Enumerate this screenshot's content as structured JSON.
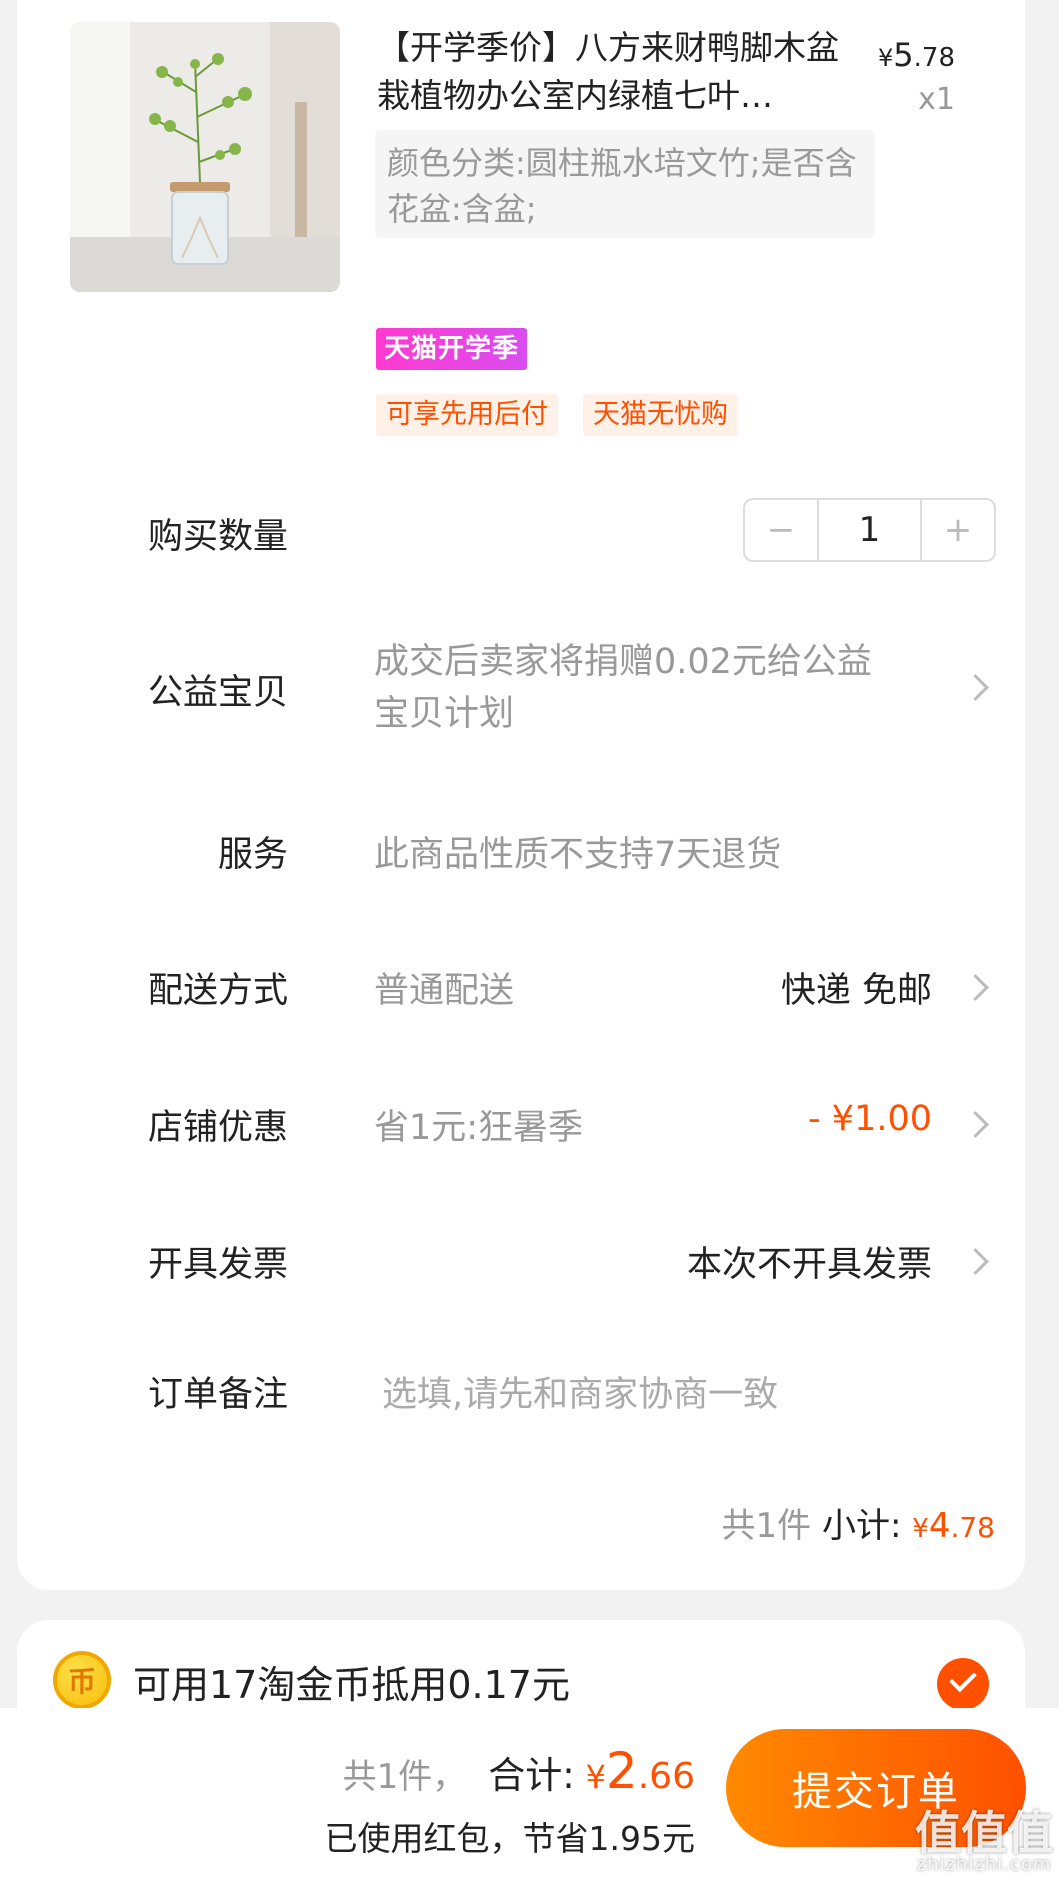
{
  "item": {
    "title": "【开学季价】八方来财鸭脚木盆栽植物办公室内绿植七叶…",
    "price": {
      "currency": "¥",
      "integer": "5",
      "decimal": ".78"
    },
    "quantity_label": "x1",
    "sku": "颜色分类:圆柱瓶水培文竹;是否含花盆:含盆;",
    "promo_badge": "天猫开学季",
    "tags": [
      "可享先用后付",
      "天猫无忧购"
    ]
  },
  "rows": {
    "quantity": {
      "label": "购买数量",
      "value": "1",
      "minus": "−",
      "plus": "+"
    },
    "charity": {
      "label": "公益宝贝",
      "value_line1": "成交后卖家将捐赠0.02元给公益",
      "value_line2": "宝贝计划"
    },
    "service": {
      "label": "服务",
      "value": "此商品性质不支持7天退货"
    },
    "delivery": {
      "label": "配送方式",
      "value": "普通配送",
      "right": "快递 免邮"
    },
    "shop_discount": {
      "label": "店铺优惠",
      "value": "省1元:狂暑季",
      "right": "- ¥1.00"
    },
    "invoice": {
      "label": "开具发票",
      "right": "本次不开具发票"
    },
    "note": {
      "label": "订单备注",
      "placeholder": "选填,请先和商家协商一致"
    }
  },
  "subtotal": {
    "count_text": "共1件",
    "label": "小计:",
    "currency": "¥",
    "integer": "4",
    "decimal": ".78"
  },
  "coins": {
    "text": "可用17淘金币抵用0.17元",
    "checked": true
  },
  "bottom": {
    "count_text": "共1件，",
    "total_label": "合计:",
    "total": {
      "currency": "¥",
      "integer": "2",
      "decimal": ".66"
    },
    "redpack_note": "已使用红包，节省1.95元",
    "submit_label": "提交订单"
  },
  "watermark": {
    "main": "值值值",
    "sub": "zhizhizhi.com"
  },
  "colors": {
    "accent": "#ff5000",
    "badge_magenta": "#ff3ad0"
  }
}
